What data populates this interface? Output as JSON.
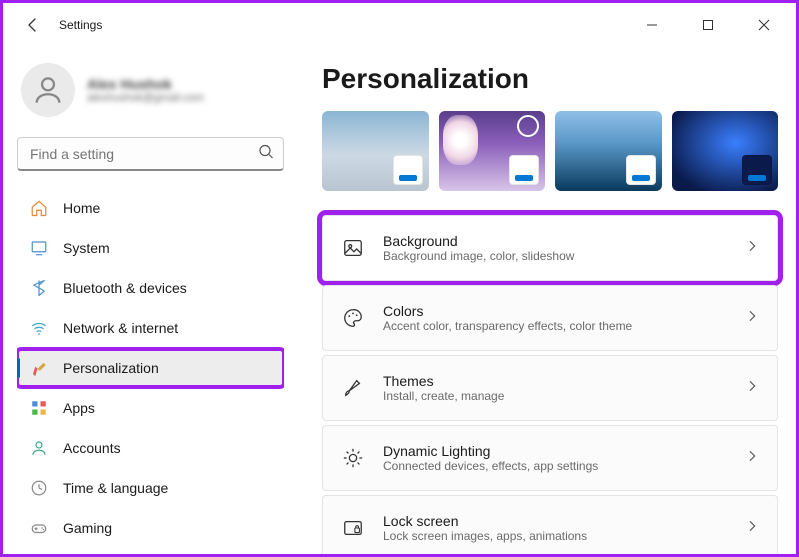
{
  "window": {
    "title": "Settings"
  },
  "profile": {
    "name": "Alex Hushok",
    "email": "alexhushok@gmail.com"
  },
  "search": {
    "placeholder": "Find a setting"
  },
  "nav": [
    {
      "label": "Home",
      "icon": "home"
    },
    {
      "label": "System",
      "icon": "system"
    },
    {
      "label": "Bluetooth & devices",
      "icon": "bluetooth"
    },
    {
      "label": "Network & internet",
      "icon": "wifi"
    },
    {
      "label": "Personalization",
      "icon": "personalization",
      "selected": true,
      "highlight": true
    },
    {
      "label": "Apps",
      "icon": "apps"
    },
    {
      "label": "Accounts",
      "icon": "accounts"
    },
    {
      "label": "Time & language",
      "icon": "time"
    },
    {
      "label": "Gaming",
      "icon": "gaming"
    }
  ],
  "page": {
    "heading": "Personalization"
  },
  "themes_preview": {
    "accents": [
      "#0078d4",
      "#0078d4",
      "#0078d4",
      "#0078d4"
    ]
  },
  "cards": [
    {
      "title": "Background",
      "sub": "Background image, color, slideshow",
      "icon": "image",
      "highlight": true
    },
    {
      "title": "Colors",
      "sub": "Accent color, transparency effects, color theme",
      "icon": "palette"
    },
    {
      "title": "Themes",
      "sub": "Install, create, manage",
      "icon": "brush"
    },
    {
      "title": "Dynamic Lighting",
      "sub": "Connected devices, effects, app settings",
      "icon": "light"
    },
    {
      "title": "Lock screen",
      "sub": "Lock screen images, apps, animations",
      "icon": "lock"
    }
  ]
}
